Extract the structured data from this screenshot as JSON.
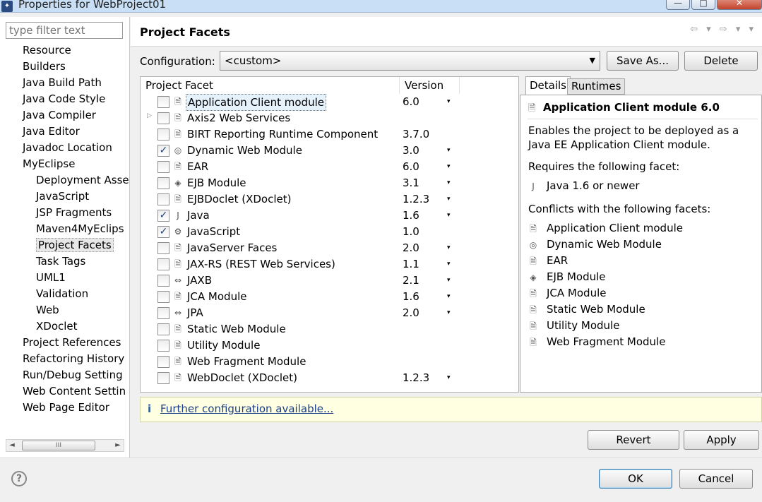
{
  "window": {
    "title": "Properties for WebProject01",
    "minimize_glyph": "—",
    "maximize_glyph": "□",
    "close_glyph": "✕"
  },
  "filter": {
    "placeholder": "type filter text"
  },
  "nav": {
    "items": [
      {
        "label": "Resource",
        "level": 1
      },
      {
        "label": "Builders",
        "level": 1
      },
      {
        "label": "Java Build Path",
        "level": 1
      },
      {
        "label": "Java Code Style",
        "level": 1
      },
      {
        "label": "Java Compiler",
        "level": 1
      },
      {
        "label": "Java Editor",
        "level": 1
      },
      {
        "label": "Javadoc Location",
        "level": 1
      },
      {
        "label": "MyEclipse",
        "level": 1
      },
      {
        "label": "Deployment Asse",
        "level": 2
      },
      {
        "label": "JavaScript",
        "level": 2
      },
      {
        "label": "JSP Fragments",
        "level": 2
      },
      {
        "label": "Maven4MyEclips",
        "level": 2
      },
      {
        "label": "Project Facets",
        "level": 2,
        "selected": true
      },
      {
        "label": "Task Tags",
        "level": 2
      },
      {
        "label": "UML1",
        "level": 2
      },
      {
        "label": "Validation",
        "level": 2
      },
      {
        "label": "Web",
        "level": 2
      },
      {
        "label": "XDoclet",
        "level": 2
      },
      {
        "label": "Project References",
        "level": 1
      },
      {
        "label": "Refactoring History",
        "level": 1
      },
      {
        "label": "Run/Debug Setting",
        "level": 1
      },
      {
        "label": "Web Content Settin",
        "level": 1
      },
      {
        "label": "Web Page Editor",
        "level": 1
      }
    ],
    "scroll_left": "◄",
    "scroll_right": "►",
    "scroll_thumb": "III"
  },
  "page": {
    "title": "Project Facets",
    "nav_arrows": "⇦ ▾ ⇨ ▾ ▾"
  },
  "configuration": {
    "label": "Configuration:",
    "value": "<custom>",
    "dropdown_glyph": "▼",
    "save_as_label": "Save As...",
    "delete_label": "Delete"
  },
  "facets": {
    "header_facet": "Project Facet",
    "header_version": "Version",
    "dropdown_glyph": "▾",
    "expander_glyph": "▷",
    "rows": [
      {
        "name": "Application Client module",
        "version": "6.0",
        "has_dropdown": true,
        "checked": false,
        "icon": "page-icon",
        "glyph": "🗎",
        "selected": true
      },
      {
        "name": "Axis2 Web Services",
        "version": "",
        "has_dropdown": false,
        "checked": false,
        "icon": "page-icon",
        "glyph": "🗎",
        "expandable": true
      },
      {
        "name": "BIRT Reporting Runtime Component",
        "version": "3.7.0",
        "has_dropdown": false,
        "checked": false,
        "icon": "page-icon",
        "glyph": "🗎"
      },
      {
        "name": "Dynamic Web Module",
        "version": "3.0",
        "has_dropdown": true,
        "checked": true,
        "icon": "globe-page-icon",
        "glyph": "◎"
      },
      {
        "name": "EAR",
        "version": "6.0",
        "has_dropdown": true,
        "checked": false,
        "icon": "page-icon",
        "glyph": "🗎"
      },
      {
        "name": "EJB Module",
        "version": "3.1",
        "has_dropdown": true,
        "checked": false,
        "icon": "bean-icon",
        "glyph": "◈"
      },
      {
        "name": "EJBDoclet (XDoclet)",
        "version": "1.2.3",
        "has_dropdown": true,
        "checked": false,
        "icon": "page-icon",
        "glyph": "🗎"
      },
      {
        "name": "Java",
        "version": "1.6",
        "has_dropdown": true,
        "checked": true,
        "icon": "java-icon",
        "glyph": "J"
      },
      {
        "name": "JavaScript",
        "version": "1.0",
        "has_dropdown": false,
        "checked": true,
        "icon": "javascript-icon",
        "glyph": "⚙"
      },
      {
        "name": "JavaServer Faces",
        "version": "2.0",
        "has_dropdown": true,
        "checked": false,
        "icon": "page-icon",
        "glyph": "🗎"
      },
      {
        "name": "JAX-RS (REST Web Services)",
        "version": "1.1",
        "has_dropdown": true,
        "checked": false,
        "icon": "page-icon",
        "glyph": "🗎"
      },
      {
        "name": "JAXB",
        "version": "2.1",
        "has_dropdown": true,
        "checked": false,
        "icon": "arrows-icon",
        "glyph": "⇔"
      },
      {
        "name": "JCA Module",
        "version": "1.6",
        "has_dropdown": true,
        "checked": false,
        "icon": "page-icon",
        "glyph": "🗎"
      },
      {
        "name": "JPA",
        "version": "2.0",
        "has_dropdown": true,
        "checked": false,
        "icon": "arrows-icon",
        "glyph": "⇔"
      },
      {
        "name": "Static Web Module",
        "version": "",
        "has_dropdown": false,
        "checked": false,
        "icon": "page-icon",
        "glyph": "🗎"
      },
      {
        "name": "Utility Module",
        "version": "",
        "has_dropdown": false,
        "checked": false,
        "icon": "page-icon",
        "glyph": "🗎"
      },
      {
        "name": "Web Fragment Module",
        "version": "",
        "has_dropdown": false,
        "checked": false,
        "icon": "page-icon",
        "glyph": "🗎"
      },
      {
        "name": "WebDoclet (XDoclet)",
        "version": "1.2.3",
        "has_dropdown": true,
        "checked": false,
        "icon": "page-icon",
        "glyph": "🗎"
      }
    ]
  },
  "details": {
    "tab_details": "Details",
    "tab_runtimes": "Runtimes",
    "title": "Application Client module 6.0",
    "title_glyph": "🗎",
    "description": "Enables the project to be deployed as a Java EE Application Client module.",
    "requires_label": "Requires the following facet:",
    "requires": [
      {
        "label": "Java 1.6 or newer",
        "icon": "java-icon",
        "glyph": "J"
      }
    ],
    "conflicts_label": "Conflicts with the following facets:",
    "conflicts": [
      {
        "label": "Application Client module",
        "icon": "page-icon",
        "glyph": "🗎"
      },
      {
        "label": "Dynamic Web Module",
        "icon": "globe-page-icon",
        "glyph": "◎"
      },
      {
        "label": "EAR",
        "icon": "page-icon",
        "glyph": "🗎"
      },
      {
        "label": "EJB Module",
        "icon": "bean-icon",
        "glyph": "◈"
      },
      {
        "label": "JCA Module",
        "icon": "page-icon",
        "glyph": "🗎"
      },
      {
        "label": "Static Web Module",
        "icon": "page-icon",
        "glyph": "🗎"
      },
      {
        "label": "Utility Module",
        "icon": "page-icon",
        "glyph": "🗎"
      },
      {
        "label": "Web Fragment Module",
        "icon": "page-icon",
        "glyph": "🗎"
      }
    ]
  },
  "info": {
    "glyph": "i",
    "link": "Further configuration available..."
  },
  "buttons": {
    "revert": "Revert",
    "apply": "Apply",
    "ok": "OK",
    "cancel": "Cancel",
    "help_glyph": "?"
  },
  "colors": {
    "link": "#1a3e8c",
    "info_bg": "#ffffe1",
    "checkmark": "#23407a"
  }
}
